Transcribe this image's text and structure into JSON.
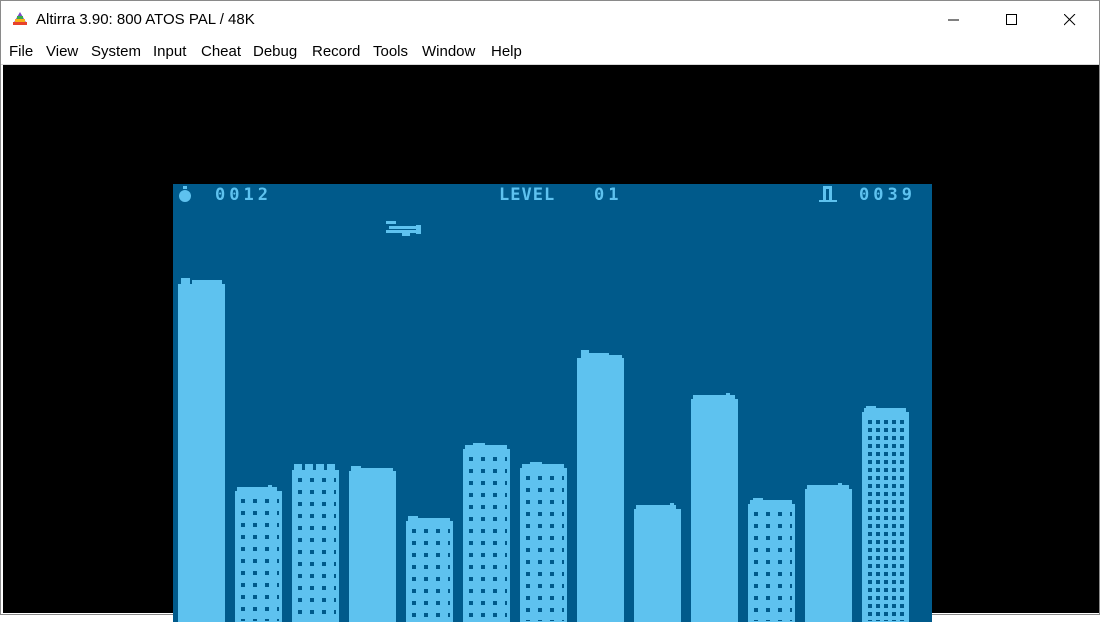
{
  "window": {
    "title": "Altirra 3.90: 800 ATOS PAL / 48K",
    "controls": [
      "minimize",
      "maximize",
      "close"
    ]
  },
  "menu": [
    "File",
    "View",
    "System",
    "Input",
    "Cheat",
    "Debug",
    "Record",
    "Tools",
    "Window",
    "Help"
  ],
  "game": {
    "bombs": "0012",
    "level_label": "LEVEL",
    "level": "01",
    "score": "0039",
    "colors": {
      "sky": "#005a8b",
      "building": "#5ec2ef",
      "border": "#000000"
    },
    "icons": {
      "bomb": "bomb-icon",
      "building": "building-icon",
      "plane": "plane-icon"
    }
  }
}
